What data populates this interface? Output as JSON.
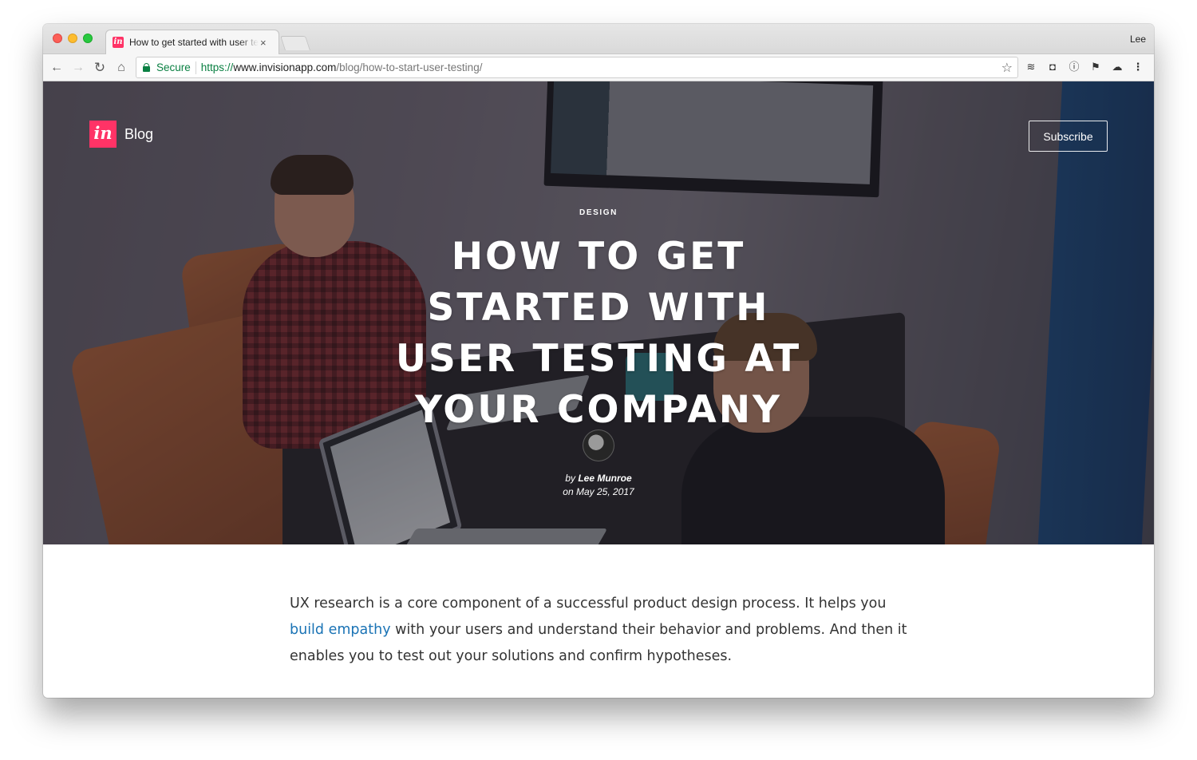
{
  "browser": {
    "tab_title": "How to get started with user testing at your company",
    "tab_close": "×",
    "profile_name": "Lee",
    "favicon_text": "in",
    "secure_label": "Secure",
    "url_scheme": "https://",
    "url_host": "www.invisionapp.com",
    "url_path": "/blog/how-to-start-user-testing/",
    "icons": [
      "back-icon",
      "forward-icon",
      "reload-icon",
      "home-icon",
      "lock-icon",
      "star-icon",
      "buffer-icon",
      "pocket-icon",
      "info-icon",
      "flag-icon",
      "cloud-icon",
      "menu-icon"
    ]
  },
  "site": {
    "logo_text": "in",
    "logo_color": "#ff3366",
    "blog_label": "Blog",
    "subscribe_label": "Subscribe"
  },
  "hero": {
    "category": "DESIGN",
    "title": "HOW TO GET STARTED WITH USER TESTING AT YOUR COMPANY",
    "byline_prefix": "by",
    "author": "Lee Munroe",
    "date_prefix": "on",
    "date": "May 25, 2017"
  },
  "article": {
    "p1_before": "UX research is a core component of a successful product design process. It helps you ",
    "p1_link": "build empathy",
    "p1_after": " with your users and understand their behavior and problems. And then it enables you to test out your solutions and confirm hypotheses.",
    "link_color": "#1a73b5"
  }
}
